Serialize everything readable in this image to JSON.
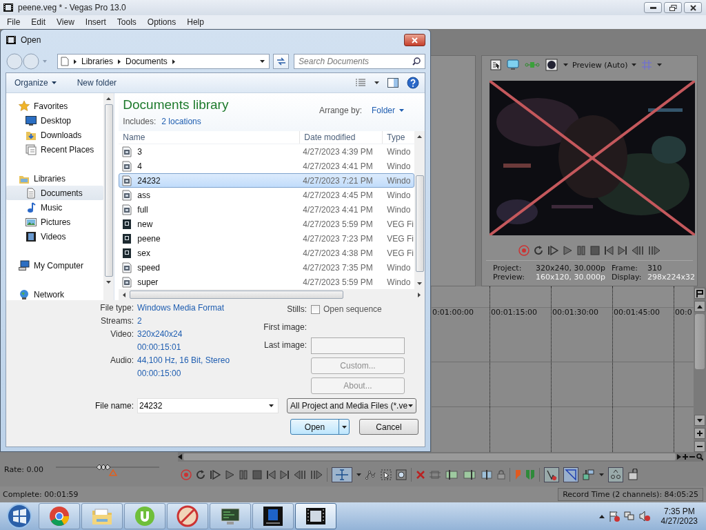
{
  "window": {
    "title": "peene.veg * - Vegas Pro 13.0"
  },
  "menu": [
    "File",
    "Edit",
    "View",
    "Insert",
    "Tools",
    "Options",
    "Help"
  ],
  "dialog": {
    "title": "Open",
    "breadcrumb": [
      "Libraries",
      "Documents"
    ],
    "search": {
      "placeholder": "Search Documents"
    },
    "commands": [
      {
        "label": "Organize",
        "menu": true
      },
      {
        "label": "New folder",
        "menu": false
      }
    ],
    "nav": [
      {
        "label": "Favorites",
        "kind": "star",
        "selected": false,
        "children": [
          {
            "label": "Desktop",
            "kind": "desktop",
            "selected": false
          },
          {
            "label": "Downloads",
            "kind": "downloads",
            "selected": false
          },
          {
            "label": "Recent Places",
            "kind": "recent",
            "selected": false
          }
        ]
      },
      {
        "label": "Libraries",
        "kind": "library",
        "selected": false,
        "children": [
          {
            "label": "Documents",
            "kind": "document",
            "selected": true
          },
          {
            "label": "Music",
            "kind": "music",
            "selected": false
          },
          {
            "label": "Pictures",
            "kind": "pictures",
            "selected": false
          },
          {
            "label": "Videos",
            "kind": "videos",
            "selected": false
          }
        ]
      },
      {
        "label": "My Computer",
        "kind": "computer",
        "selected": false
      },
      {
        "label": "Network",
        "kind": "network",
        "selected": false
      }
    ],
    "library": {
      "title": "Documents library",
      "includes_label": "Includes:",
      "includes_link": "2 locations",
      "arrange_label": "Arrange by:",
      "arrange_value": "Folder"
    },
    "columns": [
      "Name",
      "Date modified",
      "Type"
    ],
    "files": [
      {
        "name": "3",
        "date": "4/27/2023 4:39 PM",
        "type": "Windo",
        "kind": "media",
        "selected": false
      },
      {
        "name": "4",
        "date": "4/27/2023 4:41 PM",
        "type": "Windo",
        "kind": "media",
        "selected": false
      },
      {
        "name": "24232",
        "date": "4/27/2023 7:21 PM",
        "type": "Windo",
        "kind": "media",
        "selected": true
      },
      {
        "name": "ass",
        "date": "4/27/2023 4:45 PM",
        "type": "Windo",
        "kind": "media",
        "selected": false
      },
      {
        "name": "full",
        "date": "4/27/2023 4:41 PM",
        "type": "Windo",
        "kind": "media",
        "selected": false
      },
      {
        "name": "new",
        "date": "4/27/2023 5:59 PM",
        "type": "VEG Fi",
        "kind": "project",
        "selected": false
      },
      {
        "name": "peene",
        "date": "4/27/2023 7:23 PM",
        "type": "VEG Fi",
        "kind": "project",
        "selected": false
      },
      {
        "name": "sex",
        "date": "4/27/2023 4:38 PM",
        "type": "VEG Fi",
        "kind": "project",
        "selected": false
      },
      {
        "name": "speed",
        "date": "4/27/2023 7:35 PM",
        "type": "Windo",
        "kind": "media",
        "selected": false
      },
      {
        "name": "super",
        "date": "4/27/2023 5:59 PM",
        "type": "Windo",
        "kind": "media",
        "selected": false
      }
    ],
    "info": [
      {
        "label": "File type:",
        "values": [
          "Windows Media Format"
        ]
      },
      {
        "label": "Streams:",
        "values": [
          "2"
        ]
      },
      {
        "label": "Video:",
        "values": [
          "320x240x24",
          "00:00:15:01"
        ]
      },
      {
        "label": "Audio:",
        "values": [
          "44,100 Hz, 16 Bit, Stereo",
          "00:00:15:00"
        ]
      }
    ],
    "stills": {
      "label": "Stills:",
      "option": "Open sequence",
      "checked": false,
      "first_label": "First image:",
      "last_label": "Last image:"
    },
    "side_buttons": [
      {
        "label": "Custom...",
        "disabled": true
      },
      {
        "label": "About...",
        "disabled": true
      }
    ],
    "file_name": {
      "label": "File name:",
      "value": "24232"
    },
    "filter": "All Project and Media Files (*.ve",
    "open": "Open",
    "cancel": "Cancel"
  },
  "preview": {
    "quality": "Preview (Auto)",
    "info": [
      {
        "label": "Project:",
        "value": "320x240, 30.000p"
      },
      {
        "label": "Frame:",
        "value": "310"
      },
      {
        "label": "Preview:",
        "value": "160x120, 30.000p"
      },
      {
        "label": "Display:",
        "value": "298x224x32"
      }
    ]
  },
  "timeline": {
    "ticks": [
      "0:01:00:00",
      "00:01:15:00",
      "00:01:30:00",
      "00:01:45:00",
      "00:0"
    ]
  },
  "transport": {
    "rate": "Rate: 0.00",
    "level": 0.5
  },
  "status": {
    "progress": "Complete: 00:01:59",
    "record_time": "Record Time (2 channels): 84:05:25"
  },
  "taskbar": {
    "apps": [
      {
        "kind": "chrome",
        "active": false
      },
      {
        "kind": "folder",
        "active": false
      },
      {
        "kind": "torrent",
        "active": false
      },
      {
        "kind": "blocked",
        "active": false
      },
      {
        "kind": "monitor",
        "active": false
      },
      {
        "kind": "tile",
        "active": false
      },
      {
        "kind": "film",
        "active": true
      }
    ],
    "time": "7:35 PM",
    "date": "4/27/2023"
  }
}
